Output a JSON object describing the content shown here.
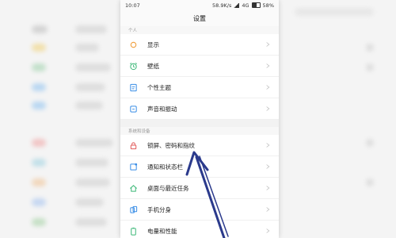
{
  "status_bar": {
    "time": "10:07",
    "speed": "58.9K/s",
    "network": "4G",
    "battery": "58%"
  },
  "header": {
    "title": "设置"
  },
  "sections": [
    {
      "header": "个人",
      "items": [
        {
          "label": "显示",
          "icon": "sun-icon"
        },
        {
          "label": "壁纸",
          "icon": "alarm-clock-icon"
        },
        {
          "label": "个性主题",
          "icon": "theme-icon"
        },
        {
          "label": "声音和振动",
          "icon": "sound-icon"
        }
      ]
    },
    {
      "header": "系统和设备",
      "items": [
        {
          "label": "锁屏、密码和指纹",
          "icon": "lock-icon"
        },
        {
          "label": "通知和状态栏",
          "icon": "notification-icon"
        },
        {
          "label": "桌面与最近任务",
          "icon": "home-icon"
        },
        {
          "label": "手机分身",
          "icon": "clone-icon"
        },
        {
          "label": "电量和性能",
          "icon": "battery-icon"
        }
      ]
    }
  ],
  "colors": {
    "accent_orange": "#f0a040",
    "accent_green": "#3cb878",
    "accent_red": "#e25c5c",
    "accent_blue": "#3a8ee6",
    "arrow": "#2b3a8c"
  }
}
